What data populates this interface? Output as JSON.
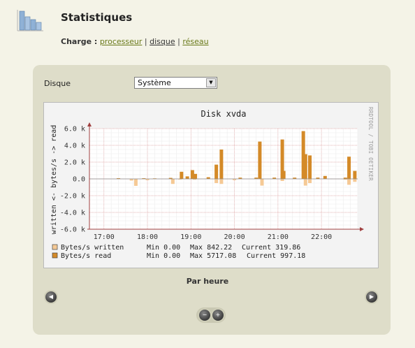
{
  "page": {
    "title": "Statistiques"
  },
  "charge": {
    "label": "Charge :",
    "links": [
      "processeur",
      "disque",
      "réseau"
    ],
    "separator": "|"
  },
  "filter": {
    "label": "Disque",
    "selected": "Système"
  },
  "graph": {
    "title": "Disk xvda",
    "side_text": "RRDTOOL / TOBI OETIKER",
    "legend": [
      {
        "name": "Bytes/s written",
        "min": "Min 0.00",
        "max": "Max 842.22",
        "current": "Current 319.86",
        "color": "#f5c995"
      },
      {
        "name": "Bytes/s read",
        "min": "Min 0.00",
        "max": "Max 5717.08",
        "current": "Current 997.18",
        "color": "#d48a28"
      }
    ]
  },
  "chart_data": {
    "type": "bar",
    "title": "Disk xvda",
    "ylabel": "written <- bytes/s -> read",
    "xlabel": "",
    "x_ticks": [
      "17:00",
      "18:00",
      "19:00",
      "20:00",
      "21:00",
      "22:00"
    ],
    "y_ticks": [
      "6.0 k",
      "4.0 k",
      "2.0 k",
      "0.0",
      "-2.0 k",
      "-4.0 k",
      "-6.0 k"
    ],
    "ylim": [
      -6000,
      6000
    ],
    "xlim": [
      "16:40",
      "22:50"
    ],
    "grid": true,
    "legend_position": "bottom",
    "series": [
      {
        "name": "Bytes/s read",
        "color": "#d48a28",
        "points": [
          [
            "17:20",
            80
          ],
          [
            "17:55",
            80
          ],
          [
            "18:10",
            60
          ],
          [
            "18:32",
            120
          ],
          [
            "18:47",
            850
          ],
          [
            "18:55",
            300
          ],
          [
            "19:02",
            1050
          ],
          [
            "19:06",
            600
          ],
          [
            "19:24",
            200
          ],
          [
            "19:35",
            1700
          ],
          [
            "19:42",
            3500
          ],
          [
            "20:08",
            150
          ],
          [
            "20:30",
            150
          ],
          [
            "20:35",
            4450
          ],
          [
            "20:55",
            150
          ],
          [
            "21:06",
            4700
          ],
          [
            "21:08",
            950
          ],
          [
            "21:23",
            150
          ],
          [
            "21:35",
            5700
          ],
          [
            "21:38",
            2950
          ],
          [
            "21:44",
            2800
          ],
          [
            "21:55",
            150
          ],
          [
            "22:05",
            350
          ],
          [
            "22:33",
            150
          ],
          [
            "22:38",
            2650
          ],
          [
            "22:46",
            950
          ]
        ]
      },
      {
        "name": "Bytes/s written",
        "color": "#f5c995",
        "points": [
          [
            "17:38",
            200
          ],
          [
            "17:44",
            830
          ],
          [
            "18:00",
            150
          ],
          [
            "18:35",
            600
          ],
          [
            "18:45",
            80
          ],
          [
            "19:05",
            100
          ],
          [
            "19:35",
            500
          ],
          [
            "19:42",
            600
          ],
          [
            "20:00",
            150
          ],
          [
            "20:38",
            800
          ],
          [
            "21:06",
            250
          ],
          [
            "21:38",
            800
          ],
          [
            "21:44",
            500
          ],
          [
            "22:33",
            100
          ],
          [
            "22:38",
            700
          ],
          [
            "22:46",
            350
          ]
        ]
      }
    ]
  },
  "nav": {
    "caption": "Par heure",
    "prev_glyph": "◀",
    "next_glyph": "▶",
    "zoom_out_glyph": "−",
    "zoom_in_glyph": "+"
  }
}
